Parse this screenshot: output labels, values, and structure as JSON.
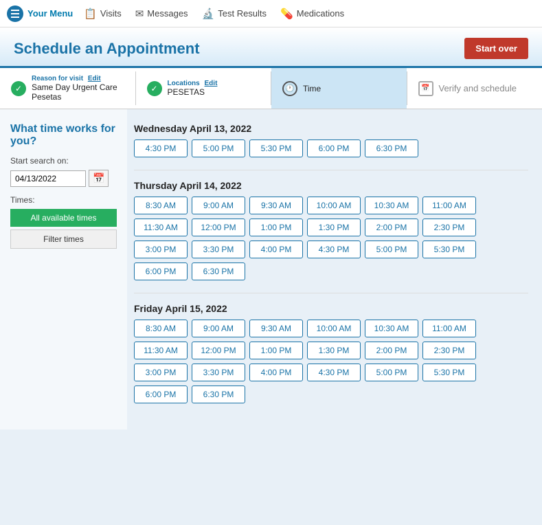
{
  "nav": {
    "menu_label": "Your Menu",
    "items": [
      {
        "label": "Visits",
        "icon": "📋"
      },
      {
        "label": "Messages",
        "icon": "✉"
      },
      {
        "label": "Test Results",
        "icon": "🔬"
      },
      {
        "label": "Medications",
        "icon": "💊"
      }
    ]
  },
  "header": {
    "title": "Schedule an Appointment",
    "start_over": "Start over"
  },
  "steps": [
    {
      "type": "check",
      "top_label": "Reason for visit",
      "edit_label": "Edit",
      "main_label": "Same Day Urgent Care Pesetas"
    },
    {
      "type": "check",
      "top_label": "Locations",
      "edit_label": "Edit",
      "main_label": "PESETAS"
    },
    {
      "type": "clock",
      "top_label": "",
      "edit_label": "",
      "main_label": "Time",
      "active": true
    },
    {
      "type": "cal",
      "top_label": "",
      "edit_label": "",
      "main_label": "Verify and schedule"
    }
  ],
  "main_title": "What time works for you?",
  "sidebar": {
    "start_search_label": "Start search on:",
    "date_value": "04/13/2022",
    "times_label": "Times:",
    "all_times_label": "All available times",
    "filter_label": "Filter times"
  },
  "days": [
    {
      "title": "Wednesday April 13, 2022",
      "times": [
        "4:30 PM",
        "5:00 PM",
        "5:30 PM",
        "6:00 PM",
        "6:30 PM"
      ]
    },
    {
      "title": "Thursday April 14, 2022",
      "times": [
        "8:30 AM",
        "9:00 AM",
        "9:30 AM",
        "10:00 AM",
        "10:30 AM",
        "11:00 AM",
        "11:30 AM",
        "12:00 PM",
        "1:00 PM",
        "1:30 PM",
        "2:00 PM",
        "2:30 PM",
        "3:00 PM",
        "3:30 PM",
        "4:00 PM",
        "4:30 PM",
        "5:00 PM",
        "5:30 PM",
        "6:00 PM",
        "6:30 PM"
      ]
    },
    {
      "title": "Friday April 15, 2022",
      "times": [
        "8:30 AM",
        "9:00 AM",
        "9:30 AM",
        "10:00 AM",
        "10:30 AM",
        "11:00 AM",
        "11:30 AM",
        "12:00 PM",
        "1:00 PM",
        "1:30 PM",
        "2:00 PM",
        "2:30 PM",
        "3:00 PM",
        "3:30 PM",
        "4:00 PM",
        "4:30 PM",
        "5:00 PM",
        "5:30 PM",
        "6:00 PM",
        "6:30 PM"
      ]
    }
  ]
}
